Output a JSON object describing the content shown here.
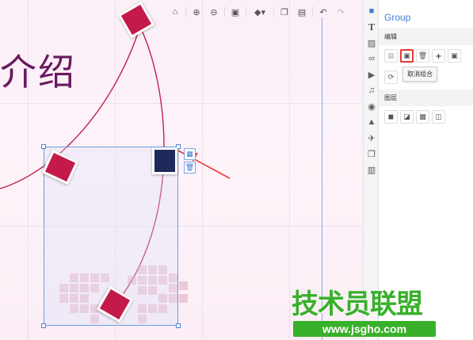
{
  "toolbar": {
    "buttons": [
      {
        "name": "home-icon",
        "glyph": "⌂"
      },
      {
        "name": "zoom-in-icon",
        "glyph": "⊕"
      },
      {
        "name": "zoom-out-icon",
        "glyph": "⊖"
      },
      {
        "name": "lock-icon",
        "glyph": "🔒"
      },
      {
        "name": "fill-icon",
        "glyph": "◆▾"
      },
      {
        "name": "copy-icon",
        "glyph": "❐"
      },
      {
        "name": "paste-icon",
        "glyph": "📋"
      },
      {
        "name": "undo-icon",
        "glyph": "↶"
      },
      {
        "name": "redo-icon",
        "glyph": "↷"
      }
    ]
  },
  "canvas": {
    "title_text": "介绍"
  },
  "side_icons": [
    "group-icon",
    "text-icon",
    "image-icon",
    "link-icon",
    "video-icon",
    "music-icon",
    "compass-icon",
    "graduation-icon",
    "plane-icon",
    "layers-icon",
    "layout-icon"
  ],
  "panel": {
    "title": "Group",
    "edit_label": "编辑",
    "layer_label": "图层",
    "tooltip": "取消组合",
    "edit_buttons": [
      "group-icon",
      "ungroup-icon",
      "delete-icon",
      "add-icon",
      "lock-icon"
    ],
    "layer_buttons": [
      "bring-front-icon",
      "bring-forward-icon",
      "send-backward-icon",
      "send-back-icon"
    ]
  },
  "watermark": {
    "name": "技术员联盟",
    "url": "www.jsgho.com"
  },
  "colors": {
    "accent": "#3d7fd6",
    "highlight": "#e53935",
    "watermark": "#38b02a",
    "title": "#6a1a5e",
    "card": "#c41a4a"
  }
}
